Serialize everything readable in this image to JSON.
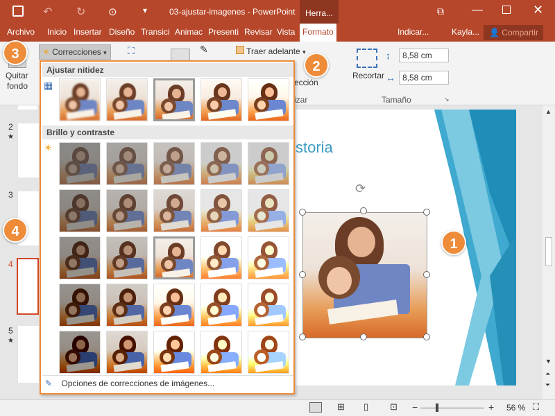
{
  "window": {
    "title": "03-ajustar-imagenes - PowerPoint",
    "context_tab": "Herra...",
    "save_icon": "save-icon"
  },
  "tabs": [
    {
      "label": "Archivo"
    },
    {
      "label": "Inicio"
    },
    {
      "label": "Insertar"
    },
    {
      "label": "Diseño"
    },
    {
      "label": "Transici"
    },
    {
      "label": "Animac"
    },
    {
      "label": "Presenti"
    },
    {
      "label": "Revisar"
    },
    {
      "label": "Vista"
    },
    {
      "label": "Formato"
    }
  ],
  "tell_me": "Indicar...",
  "user": "Kayla...",
  "share": "Compartir",
  "ribbon": {
    "remove_bg": [
      "Quitar",
      "fondo"
    ],
    "corrections": "Correcciones",
    "bring_forward": "Traer adelante",
    "selection_fragment": "ección",
    "group_fragment": "izar",
    "crop": "Recortar",
    "size_group": "Tamaño",
    "height": "8,58 cm",
    "width": "8,58 cm"
  },
  "dropdown": {
    "section_sharpen": "Ajustar nitidez",
    "section_brightness": "Brillo y contraste",
    "footer": "Opciones de correcciones de imágenes..."
  },
  "slides": [
    {
      "num": "2"
    },
    {
      "num": "3"
    },
    {
      "num": "4"
    },
    {
      "num": "5"
    }
  ],
  "slide_title_fragment": "storia",
  "callouts": [
    "1",
    "2",
    "3",
    "4"
  ],
  "status": {
    "zoom": "56 %"
  },
  "colors": {
    "accent": "#b7472a",
    "callout": "#ee8c3a"
  }
}
